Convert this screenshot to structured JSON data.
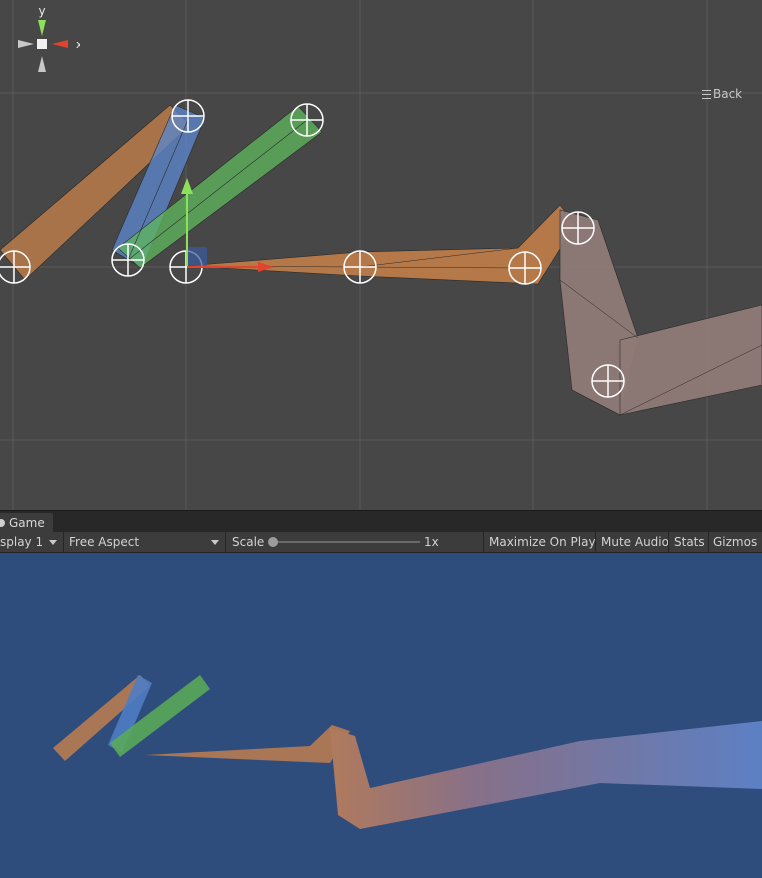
{
  "scene_view": {
    "gizmo": {
      "y_label": "y",
      "x_label": "x"
    },
    "back_label": "Back",
    "colors": {
      "background": "#474747",
      "grid": "#5a5a5a",
      "y_axis": "#8de05a",
      "x_axis": "#e0442c",
      "bone_orange": "#c9814a",
      "bone_blue": "#5b84c8",
      "bone_green": "#5fb85c",
      "bone_mauve": "#8f7a76"
    }
  },
  "game_panel": {
    "tab_label": "Game",
    "toolbar": {
      "display_label": "splay 1",
      "aspect_label": "Free Aspect",
      "scale_label": "Scale",
      "scale_value": "1x",
      "maximize_label": "Maximize On Play",
      "mute_label": "Mute Audio",
      "stats_label": "Stats",
      "gizmos_label": "Gizmos"
    },
    "colors": {
      "background": "#2f4d7c"
    }
  }
}
